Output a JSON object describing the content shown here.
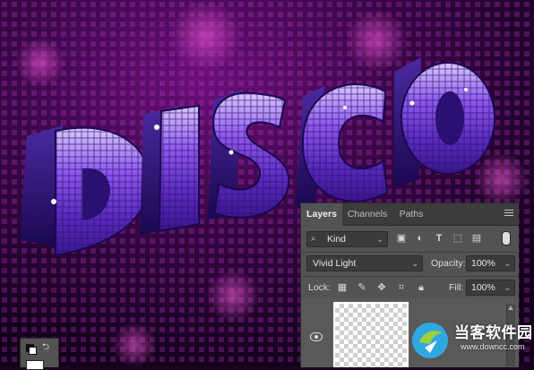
{
  "artwork": {
    "title_text": "DISCO",
    "colors": {
      "background_dark": "#1a0220",
      "background_glow": "#8a1a9a",
      "tile_purple": "#7a3fe0",
      "tile_highlight": "#d7c6ff",
      "tile_shadow": "#2a1060"
    }
  },
  "layers_panel": {
    "tabs": [
      {
        "label": "Layers",
        "active": true
      },
      {
        "label": "Channels",
        "active": false
      },
      {
        "label": "Paths",
        "active": false
      }
    ],
    "menu_icon": "hamburger-icon",
    "filter": {
      "search_icon": "search-icon",
      "kind_label": "Kind",
      "filter_icons": [
        "image-filter-icon",
        "adjustment-filter-icon",
        "type-filter-icon",
        "shape-filter-icon",
        "smart-object-filter-icon"
      ]
    },
    "blend_mode": "Vivid Light",
    "opacity_label": "Opacity:",
    "opacity_value": "100%",
    "lock_label": "Lock:",
    "lock_icons": [
      "lock-transparent-icon",
      "lock-paint-icon",
      "lock-move-icon",
      "lock-artboard-icon",
      "lock-all-icon"
    ],
    "fill_label": "Fill:",
    "fill_value": "100%",
    "layer": {
      "visible": true,
      "eye_icon": "eye-icon"
    }
  },
  "tools": {
    "swap_icon": "swap-colors-icon",
    "default_icon": "default-colors-icon"
  },
  "watermark": {
    "name": "当客软件园",
    "url": "www.downcc.com"
  }
}
